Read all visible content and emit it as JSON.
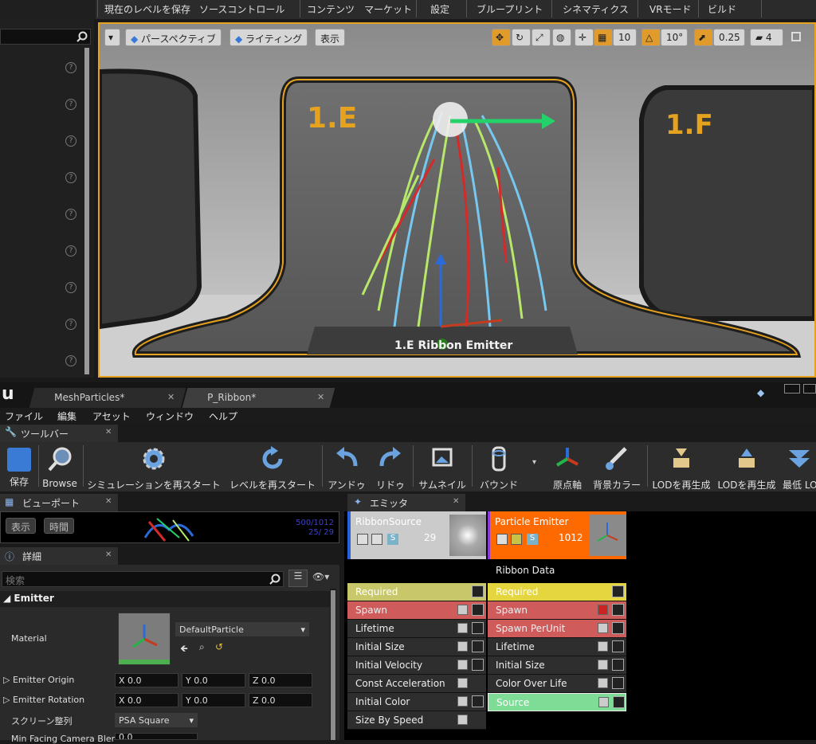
{
  "colors": {
    "accent_orange": "#e5a21f",
    "required_yellow": "#e5d53e",
    "spawn_red": "#cf5b5b",
    "source_green": "#7fdc97",
    "particle_header": "#ff6a00"
  },
  "main_toolbar": {
    "labels": [
      "現在のレベルを保存",
      "ソースコントロール",
      "コンテンツ",
      "マーケット",
      "設定",
      "ブループリント",
      "シネマティクス",
      "VRモード",
      "ビルド"
    ]
  },
  "viewport": {
    "perspective_label": "パースペクティブ",
    "lighting_label": "ライティング",
    "show_label": "表示",
    "grid_value": "10",
    "rotation_value": "10°",
    "scale_value": "0.25",
    "camera_speed": "4",
    "sign_left": "1.E",
    "sign_right": "1.F",
    "pedestal_text": "1.E  Ribbon Emitter"
  },
  "doc_tabs": [
    {
      "label": "MeshParticles*"
    },
    {
      "label": "P_Ribbon*"
    }
  ],
  "menubar": {
    "items": [
      "ファイル",
      "編集",
      "アセット",
      "ウィンドウ",
      "ヘルプ"
    ]
  },
  "toolbar": {
    "tab_label": "ツールバー",
    "tools": [
      {
        "label": "保存",
        "icon": "save-icon"
      },
      {
        "label": "Browse",
        "icon": "browse-icon"
      },
      {
        "label": "シミュレーションを再スタート",
        "icon": "restart-sim-icon"
      },
      {
        "label": "レベルを再スタート",
        "icon": "restart-level-icon"
      },
      {
        "label": "アンドゥ",
        "icon": "undo-icon"
      },
      {
        "label": "リドゥ",
        "icon": "redo-icon"
      },
      {
        "label": "サムネイル",
        "icon": "thumbnail-icon"
      },
      {
        "label": "バウンド",
        "icon": "bounds-icon"
      },
      {
        "label": "原点軸",
        "icon": "origin-axis-icon"
      },
      {
        "label": "背景カラー",
        "icon": "bg-color-icon"
      },
      {
        "label": "LODを再生成",
        "icon": "lod-regen-icon"
      },
      {
        "label": "LODを再生成",
        "icon": "lod-regen2-icon"
      },
      {
        "label": "最低 LO",
        "icon": "lowest-lod-icon"
      }
    ]
  },
  "viewport_panel": {
    "tab_label": "ビューポート",
    "show_btn": "表示",
    "time_btn": "時間",
    "stat_top": "500/1012",
    "stat_bottom": "25/  29"
  },
  "details": {
    "tab_label": "詳細",
    "search_placeholder": "検索",
    "category": "Emitter",
    "material_label": "Material",
    "material_value": "DefaultParticle",
    "origin_label": "Emitter Origin",
    "rotation_label": "Emitter Rotation",
    "screen_align_label": "スクリーン整列",
    "screen_align_value": "PSA Square",
    "min_facing_label": "Min Facing Camera Blend",
    "min_facing_value": "0.0",
    "origin": {
      "x": "X  0.0",
      "y": "Y  0.0",
      "z": "Z  0.0"
    },
    "rotation": {
      "x": "X  0.0",
      "y": "Y  0.0",
      "z": "Z  0.0"
    }
  },
  "emitter_panel": {
    "tab_label": "エミッタ",
    "ribbon_source": {
      "name": "RibbonSource",
      "count": "29",
      "modules": [
        "Required",
        "Spawn",
        "Lifetime",
        "Initial Size",
        "Initial Velocity",
        "Const Acceleration",
        "Initial Color",
        "Size By Speed"
      ]
    },
    "particle_emitter": {
      "name": "Particle Emitter",
      "count": "1012",
      "type_data": "Ribbon Data",
      "modules": [
        "Required",
        "Spawn",
        "Spawn PerUnit",
        "Lifetime",
        "Initial Size",
        "Color Over Life",
        "Source"
      ]
    }
  }
}
